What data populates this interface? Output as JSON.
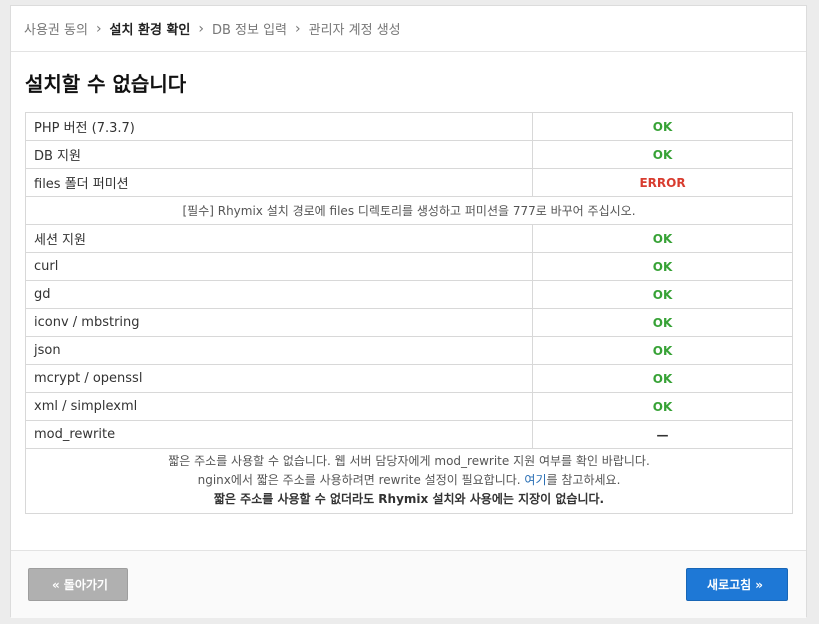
{
  "steps": [
    {
      "label": "사용권 동의",
      "active": false
    },
    {
      "label": "설치 환경 확인",
      "active": true
    },
    {
      "label": "DB 정보 입력",
      "active": false
    },
    {
      "label": "관리자 계정 생성",
      "active": false
    }
  ],
  "page_title": "설치할 수 없습니다",
  "checks": {
    "php": {
      "name": "PHP 버전 (7.3.7)",
      "status": "OK"
    },
    "db": {
      "name": "DB 지원",
      "status": "OK"
    },
    "files": {
      "name": "files 폴더 퍼미션",
      "status": "ERROR"
    },
    "files_note": "[필수] Rhymix 설치 경로에 files 디렉토리를 생성하고 퍼미션을 777로 바꾸어 주십시오.",
    "session": {
      "name": "세션 지원",
      "status": "OK"
    },
    "curl": {
      "name": "curl",
      "status": "OK"
    },
    "gd": {
      "name": "gd",
      "status": "OK"
    },
    "iconv": {
      "name": "iconv / mbstring",
      "status": "OK"
    },
    "json": {
      "name": "json",
      "status": "OK"
    },
    "mcrypt": {
      "name": "mcrypt / openssl",
      "status": "OK"
    },
    "xml": {
      "name": "xml / simplexml",
      "status": "OK"
    },
    "rewrite": {
      "name": "mod_rewrite",
      "status": "—"
    },
    "rewrite_note": {
      "line1": "짧은 주소를 사용할 수 없습니다. 웹 서버 담당자에게 mod_rewrite 지원 여부를 확인 바랍니다.",
      "line2_prefix": "nginx에서 짧은 주소를 사용하려면 rewrite 설정이 필요합니다. ",
      "line2_link": "여기",
      "line2_suffix": "를 참고하세요.",
      "line3": "짧은 주소를 사용할 수 없더라도 Rhymix 설치와 사용에는 지장이 없습니다."
    }
  },
  "buttons": {
    "back_label": "돌아가기",
    "refresh_label": "새로고침"
  },
  "colors": {
    "ok": "#37a236",
    "error": "#d83c2f",
    "primary": "#1e78d6",
    "secondary": "#b0b0b0"
  }
}
